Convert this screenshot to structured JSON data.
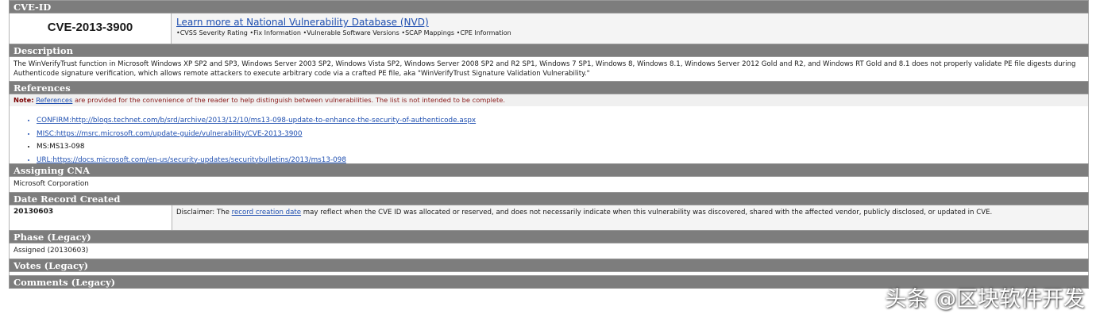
{
  "cve_id_section": {
    "header": "CVE-ID",
    "id": "CVE-2013-3900",
    "nvd_link": "Learn more at National Vulnerability Database (NVD)",
    "nvd_features": [
      "CVSS Severity Rating",
      "Fix Information",
      "Vulnerable Software Versions",
      "SCAP Mappings",
      "CPE Information"
    ]
  },
  "description": {
    "header": "Description",
    "text": "The WinVerifyTrust function in Microsoft Windows XP SP2 and SP3, Windows Server 2003 SP2, Windows Vista SP2, Windows Server 2008 SP2 and R2 SP1, Windows 7 SP1, Windows 8, Windows 8.1, Windows Server 2012 Gold and R2, and Windows RT Gold and 8.1 does not properly validate PE file digests during Authenticode signature verification, which allows remote attackers to execute arbitrary code via a crafted PE file, aka \"WinVerifyTrust Signature Validation Vulnerability.\""
  },
  "references": {
    "header": "References",
    "note_label": "Note:",
    "note_link": "References",
    "note_text": "are provided for the convenience of the reader to help distinguish between vulnerabilities. The list is not intended to be complete.",
    "items": [
      "CONFIRM:http://blogs.technet.com/b/srd/archive/2013/12/10/ms13-098-update-to-enhance-the-security-of-authenticode.aspx",
      "MISC:https://msrc.microsoft.com/update-guide/vulnerability/CVE-2013-3900",
      "MS:MS13-098",
      "URL:https://docs.microsoft.com/en-us/security-updates/securitybulletins/2013/ms13-098"
    ]
  },
  "assigning_cna": {
    "header": "Assigning CNA",
    "value": "Microsoft Corporation"
  },
  "date_record_created": {
    "header": "Date Record Created",
    "value": "20130603",
    "disclaimer_prefix": "Disclaimer: The",
    "disclaimer_link": "record creation date",
    "disclaimer_suffix": "may reflect when the CVE ID was allocated or reserved, and does not necessarily indicate when this vulnerability was discovered, shared with the affected vendor, publicly disclosed, or updated in CVE."
  },
  "phase": {
    "header": "Phase (Legacy)",
    "value": "Assigned (20130603)"
  },
  "votes": {
    "header": "Votes (Legacy)"
  },
  "comments": {
    "header": "Comments (Legacy)"
  },
  "watermark": "头条 @区块软件开发"
}
